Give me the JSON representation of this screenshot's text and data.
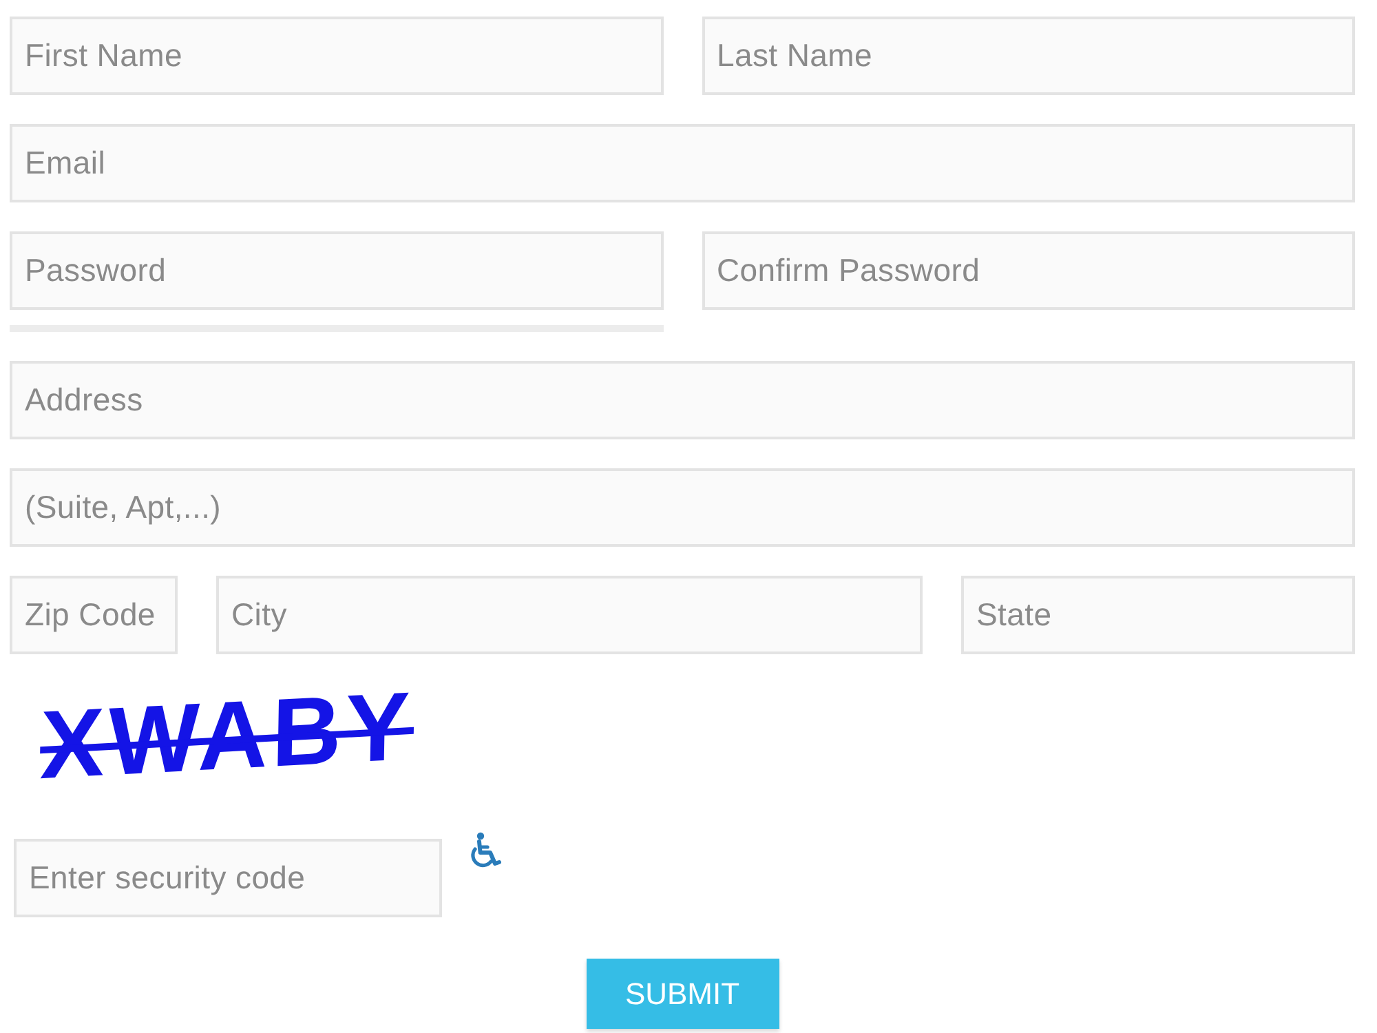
{
  "name_row": [
    {
      "placeholder": "First Name"
    },
    {
      "placeholder": "Last Name"
    }
  ],
  "email": {
    "placeholder": "Email"
  },
  "password_row": [
    {
      "placeholder": "Password"
    },
    {
      "placeholder": "Confirm Password"
    }
  ],
  "password_strength": {
    "level": 0
  },
  "address": {
    "placeholder": "Address"
  },
  "address_line_2": {
    "placeholder": "(Suite, Apt,...)"
  },
  "location_row": [
    {
      "placeholder": "Zip Code"
    },
    {
      "placeholder": "City"
    },
    {
      "placeholder": "State"
    }
  ],
  "captcha": {
    "text": "XWABY"
  },
  "security_code": {
    "placeholder": "Enter security code"
  },
  "submit": {
    "label": "SUBMIT"
  }
}
